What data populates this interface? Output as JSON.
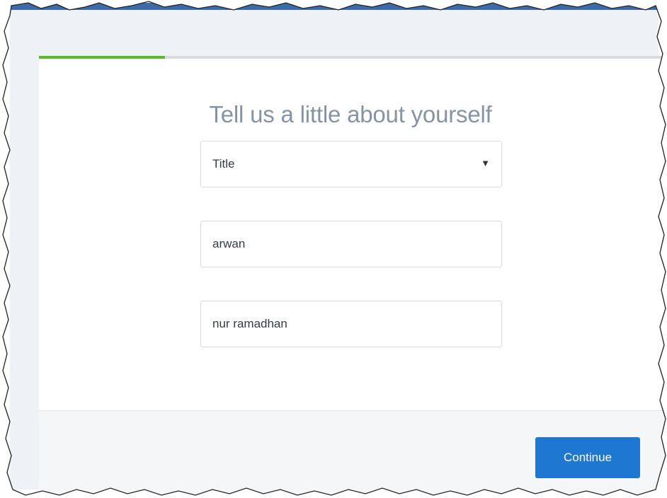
{
  "form": {
    "progress_fraction": 0.2,
    "heading": "Tell us a little about yourself",
    "title_select": {
      "selected": "Title",
      "caret_icon": "caret-down-icon"
    },
    "first_name_value": "arwan",
    "last_name_value": "nur ramadhan"
  },
  "footer": {
    "continue_label": "Continue"
  },
  "colors": {
    "accent_green": "#5ab82a",
    "button_blue": "#1e78d2",
    "heading_gray": "#8494a6",
    "header_blue": "#3d6aa8"
  }
}
